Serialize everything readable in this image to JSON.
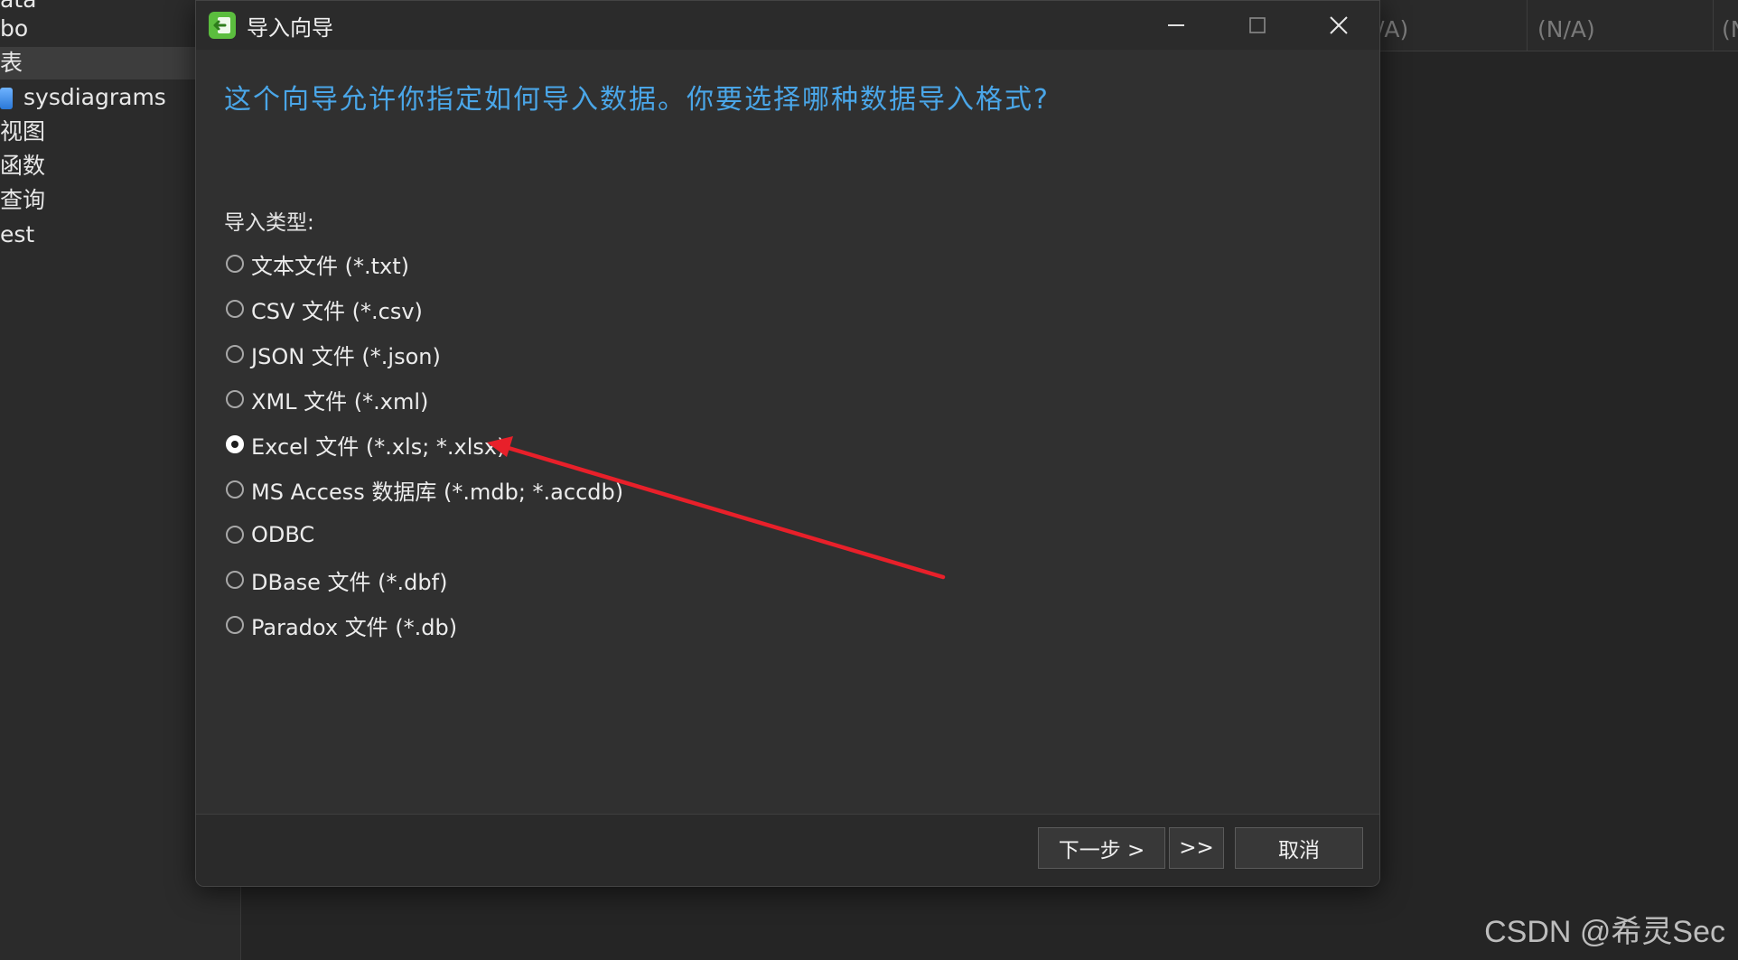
{
  "background": {
    "tree": [
      {
        "label": "ata",
        "selected": false
      },
      {
        "label": "bo",
        "selected": false
      },
      {
        "label": "表",
        "selected": true
      },
      {
        "label": "sysdiagrams",
        "selected": false,
        "icon": "database-table-icon"
      },
      {
        "label": "视图",
        "selected": false
      },
      {
        "label": "函数",
        "selected": false
      },
      {
        "label": "查询",
        "selected": false
      },
      {
        "label": "est",
        "selected": false
      }
    ],
    "grid_cells": [
      "/A)",
      "(N/A)",
      "(N"
    ],
    "watermark": "CSDN @希灵Sec"
  },
  "dialog": {
    "title": "导入向导",
    "heading": "这个向导允许你指定如何导入数据。你要选择哪种数据导入格式?",
    "group_label": "导入类型:",
    "options": [
      {
        "label": "文本文件 (*.txt)",
        "checked": false
      },
      {
        "label": "CSV 文件 (*.csv)",
        "checked": false
      },
      {
        "label": "JSON 文件 (*.json)",
        "checked": false
      },
      {
        "label": "XML 文件 (*.xml)",
        "checked": false
      },
      {
        "label": "Excel 文件 (*.xls; *.xlsx)",
        "checked": true
      },
      {
        "label": "MS Access 数据库 (*.mdb; *.accdb)",
        "checked": false
      },
      {
        "label": "ODBC",
        "checked": false
      },
      {
        "label": "DBase 文件 (*.dbf)",
        "checked": false
      },
      {
        "label": "Paradox 文件 (*.db)",
        "checked": false
      }
    ],
    "buttons": {
      "next": "下一步 >",
      "skip": ">>",
      "cancel": "取消"
    }
  },
  "colors": {
    "heading": "#4aa6e8",
    "annotation_arrow": "#e8202a",
    "app_icon": "#5bbd3e"
  }
}
